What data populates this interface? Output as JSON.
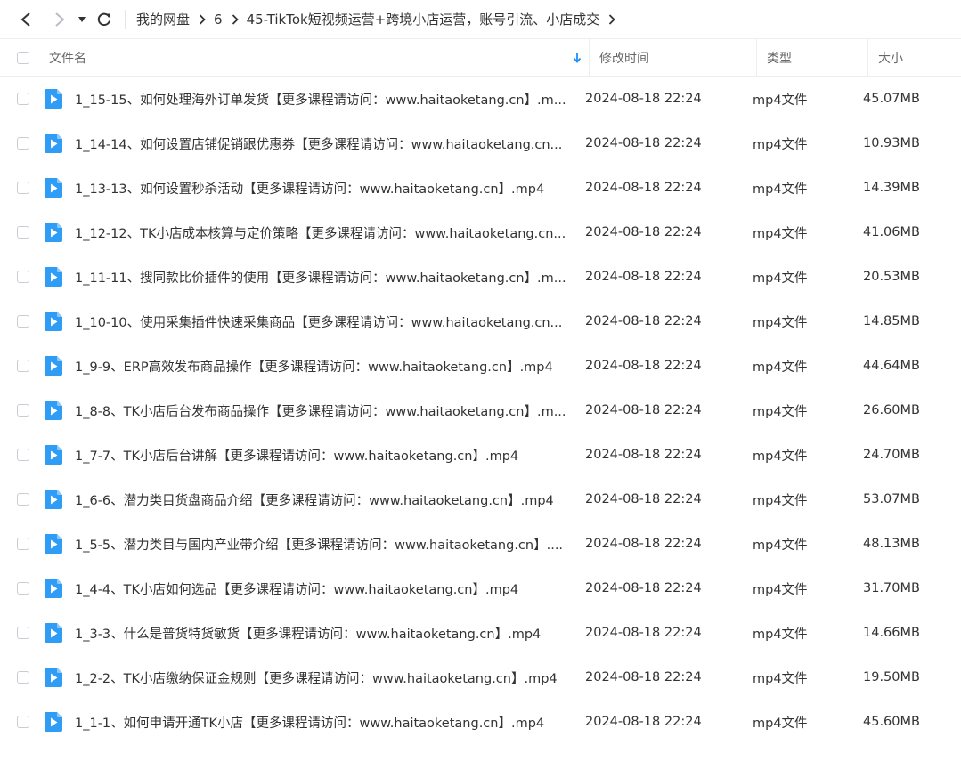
{
  "breadcrumb": {
    "items": [
      "我的网盘",
      "6",
      "45-TikTok短视频运营+跨境小店运营，账号引流、小店成交"
    ]
  },
  "table": {
    "headers": {
      "name": "文件名",
      "time": "修改时间",
      "type": "类型",
      "size": "大小"
    },
    "rows": [
      {
        "name": "1_15-15、如何处理海外订单发货【更多课程请访问：www.haitaoketang.cn】.m...",
        "time": "2024-08-18 22:24",
        "type": "mp4文件",
        "size": "45.07MB"
      },
      {
        "name": "1_14-14、如何设置店铺促销跟优惠券【更多课程请访问：www.haitaoketang.cn...",
        "time": "2024-08-18 22:24",
        "type": "mp4文件",
        "size": "10.93MB"
      },
      {
        "name": "1_13-13、如何设置秒杀活动【更多课程请访问：www.haitaoketang.cn】.mp4",
        "time": "2024-08-18 22:24",
        "type": "mp4文件",
        "size": "14.39MB"
      },
      {
        "name": "1_12-12、TK小店成本核算与定价策略【更多课程请访问：www.haitaoketang.cn...",
        "time": "2024-08-18 22:24",
        "type": "mp4文件",
        "size": "41.06MB"
      },
      {
        "name": "1_11-11、搜同款比价插件的使用【更多课程请访问：www.haitaoketang.cn】.m...",
        "time": "2024-08-18 22:24",
        "type": "mp4文件",
        "size": "20.53MB"
      },
      {
        "name": "1_10-10、使用采集插件快速采集商品【更多课程请访问：www.haitaoketang.cn...",
        "time": "2024-08-18 22:24",
        "type": "mp4文件",
        "size": "14.85MB"
      },
      {
        "name": "1_9-9、ERP高效发布商品操作【更多课程请访问：www.haitaoketang.cn】.mp4",
        "time": "2024-08-18 22:24",
        "type": "mp4文件",
        "size": "44.64MB"
      },
      {
        "name": "1_8-8、TK小店后台发布商品操作【更多课程请访问：www.haitaoketang.cn】.m...",
        "time": "2024-08-18 22:24",
        "type": "mp4文件",
        "size": "26.60MB"
      },
      {
        "name": "1_7-7、TK小店后台讲解【更多课程请访问：www.haitaoketang.cn】.mp4",
        "time": "2024-08-18 22:24",
        "type": "mp4文件",
        "size": "24.70MB"
      },
      {
        "name": "1_6-6、潜力类目货盘商品介绍【更多课程请访问：www.haitaoketang.cn】.mp4",
        "time": "2024-08-18 22:24",
        "type": "mp4文件",
        "size": "53.07MB"
      },
      {
        "name": "1_5-5、潜力类目与国内产业带介绍【更多课程请访问：www.haitaoketang.cn】....",
        "time": "2024-08-18 22:24",
        "type": "mp4文件",
        "size": "48.13MB"
      },
      {
        "name": "1_4-4、TK小店如何选品【更多课程请访问：www.haitaoketang.cn】.mp4",
        "time": "2024-08-18 22:24",
        "type": "mp4文件",
        "size": "31.70MB"
      },
      {
        "name": "1_3-3、什么是普货特货敏货【更多课程请访问：www.haitaoketang.cn】.mp4",
        "time": "2024-08-18 22:24",
        "type": "mp4文件",
        "size": "14.66MB"
      },
      {
        "name": "1_2-2、TK小店缴纳保证金规则【更多课程请访问：www.haitaoketang.cn】.mp4",
        "time": "2024-08-18 22:24",
        "type": "mp4文件",
        "size": "19.50MB"
      },
      {
        "name": "1_1-1、如何申请开通TK小店【更多课程请访问：www.haitaoketang.cn】.mp4",
        "time": "2024-08-18 22:24",
        "type": "mp4文件",
        "size": "45.60MB"
      }
    ]
  },
  "colors": {
    "accent": "#1e8ff5",
    "icon_blue": "#2f9cf6"
  }
}
